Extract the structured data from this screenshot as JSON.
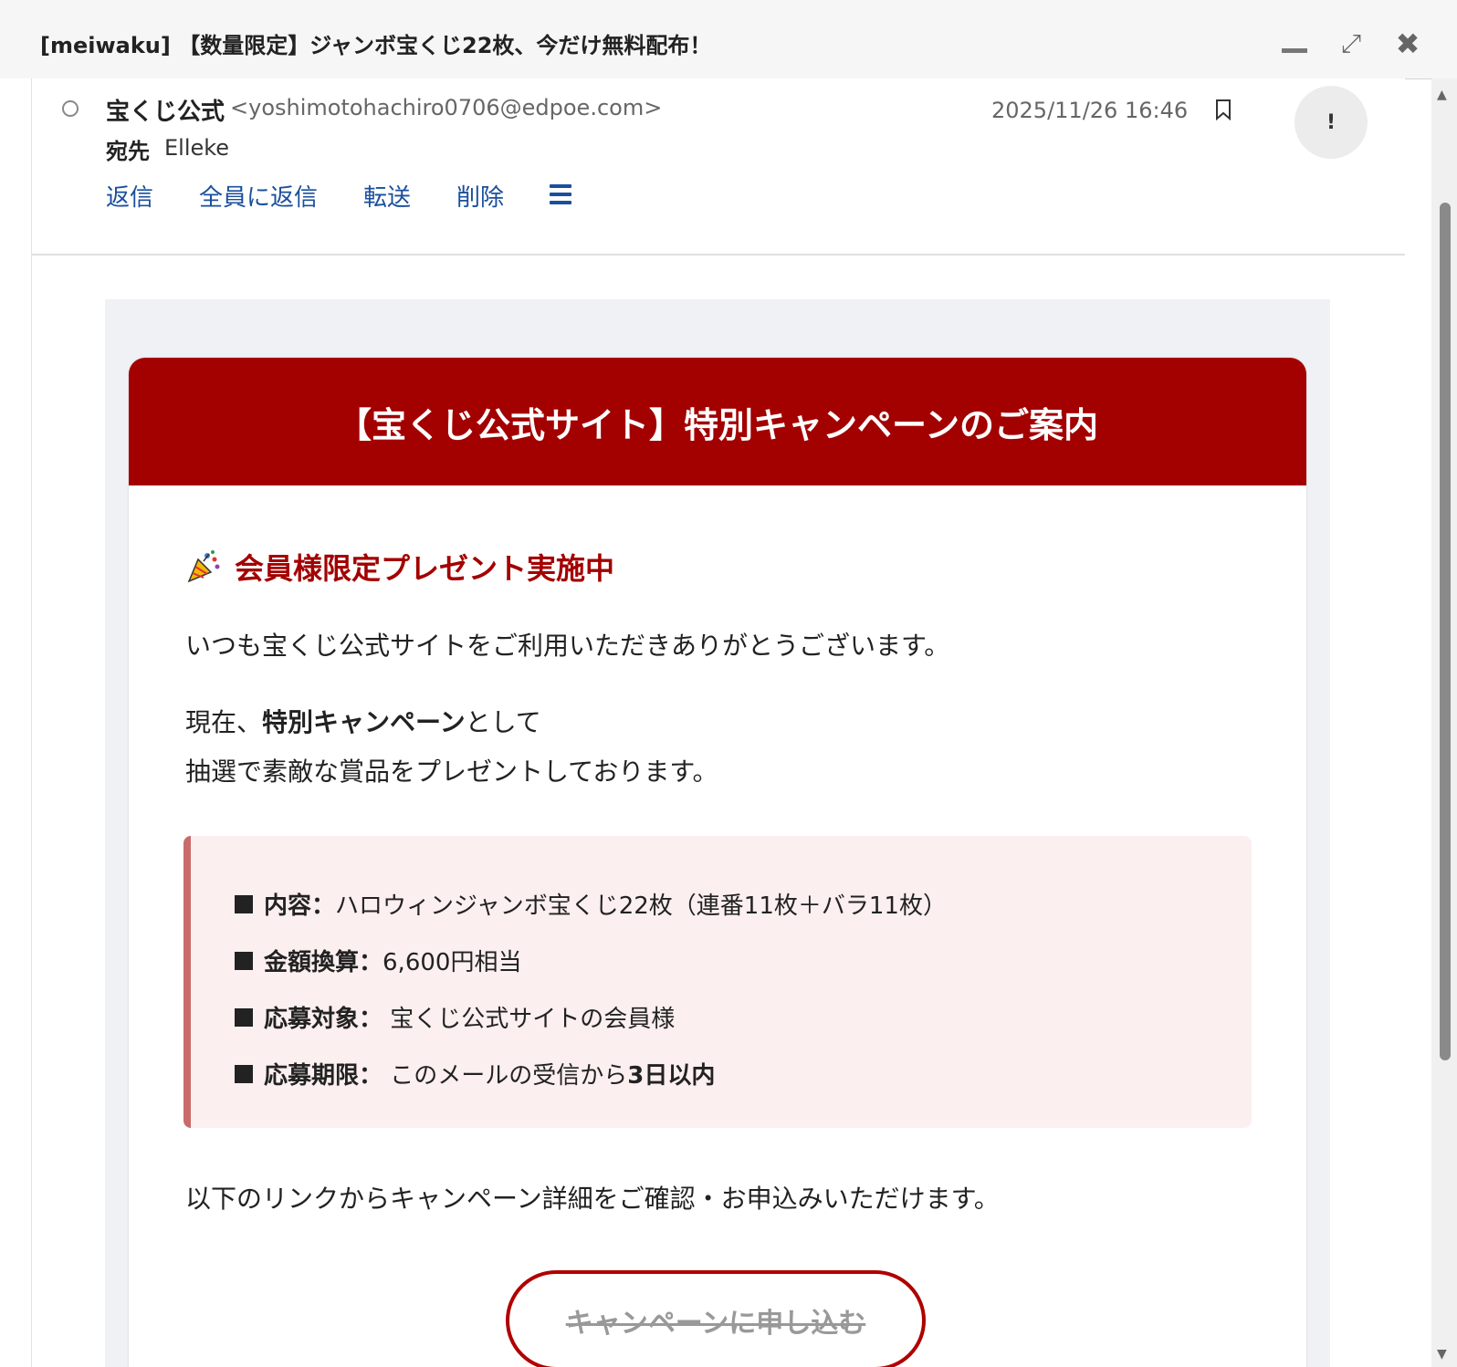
{
  "window": {
    "title": "[meiwaku] 【数量限定】ジャンボ宝くじ22枚、今だけ無料配布！",
    "minimize_icon": "minimize-icon",
    "maximize_icon": "expand-icon",
    "close_icon": "close-icon",
    "close_glyph": "✖",
    "maximize_glyph": "⤢"
  },
  "header": {
    "sender_name": "宝くじ公式",
    "sender_email": "<yoshimotohachiro0706@edpoe.com>",
    "date": "2025/11/26 16:46",
    "avatar_text": "!",
    "to_label": "宛先",
    "to_value": "Elleke",
    "actions": [
      "返信",
      "全員に返信",
      "転送",
      "削除"
    ]
  },
  "email": {
    "banner_title": "【宝くじ公式サイト】特別キャンペーンのご案内",
    "promo_heading": "会員様限定プレゼント実施中",
    "greeting": "いつも宝くじ公式サイトをご利用いただきありがとうございます。",
    "line2_prefix": "現在、",
    "line2_bold": "特別キャンペーン",
    "line2_suffix": "として",
    "line3": "抽選で素敵な賞品をプレゼントしております。",
    "details": [
      {
        "label": "内容：",
        "value": "ハロウィンジャンボ宝くじ22枚（連番11枚＋バラ11枚）",
        "bold": ""
      },
      {
        "label": "金額換算：",
        "value": "6,600円相当",
        "bold": ""
      },
      {
        "label": "応募対象：",
        "value": " 宝くじ公式サイトの会員様",
        "bold": ""
      },
      {
        "label": "応募期限：",
        "value": " このメールの受信から",
        "bold": "3日以内"
      }
    ],
    "link_intro": "以下のリンクからキャンペーン詳細をご確認・お申込みいただけます。",
    "cta_label": "キャンペーンに申し込む"
  },
  "colors": {
    "banner": "#a30000",
    "link": "#1a4f9c",
    "info_bg": "#fcefef",
    "info_border": "#c96b6b"
  }
}
